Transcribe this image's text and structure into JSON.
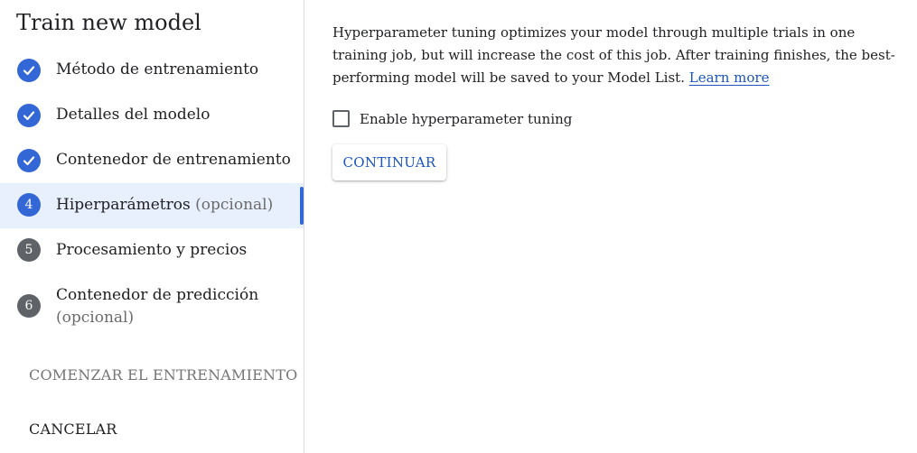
{
  "sidebar": {
    "title": "Train new model",
    "steps": [
      {
        "number": "",
        "state": "done",
        "label": "Método de entrenamiento",
        "optional": ""
      },
      {
        "number": "",
        "state": "done",
        "label": "Detalles del modelo",
        "optional": ""
      },
      {
        "number": "",
        "state": "done",
        "label": "Contenedor de entrenamiento",
        "optional": ""
      },
      {
        "number": "4",
        "state": "current",
        "label": "Hiperparámetros",
        "optional": "(opcional)"
      },
      {
        "number": "5",
        "state": "todo",
        "label": "Procesamiento y precios",
        "optional": ""
      },
      {
        "number": "6",
        "state": "todo",
        "label": "Contenedor de predicción",
        "optional": "(opcional)"
      }
    ],
    "start_training_label": "COMENZAR EL ENTRENAMIENTO",
    "cancel_label": "CANCELAR"
  },
  "main": {
    "description": "Hyperparameter tuning optimizes your model through multiple trials in one training job, but will increase the cost of this job. After training finishes, the best-performing model will be saved to your Model List.",
    "learn_more_label": "Learn more",
    "checkbox_label": "Enable hyperparameter tuning",
    "checkbox_checked": false,
    "continue_label": "CONTINUAR"
  },
  "colors": {
    "accent": "#3367d6",
    "link": "#1a55c0",
    "active_bg": "#e8f0fe",
    "todo_badge": "#5f6368"
  }
}
